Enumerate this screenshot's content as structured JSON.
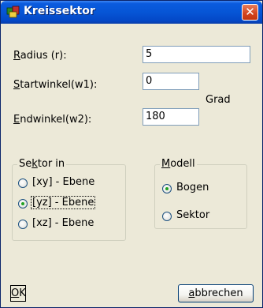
{
  "window": {
    "title": "Kreissektor",
    "close_glyph": "✕"
  },
  "fields": {
    "radius": {
      "label_u": "R",
      "label_rest": "adius (r):",
      "value": "5"
    },
    "start": {
      "label_u": "S",
      "label_rest": "tartwinkel(w1):",
      "value": "0"
    },
    "end": {
      "label_u": "E",
      "label_rest": "ndwinkel(w2):",
      "value": "180"
    },
    "unit": "Grad"
  },
  "sektor_group": {
    "title_pre": "Se",
    "title_u": "k",
    "title_post": "tor in",
    "options": [
      {
        "label": "[xy] - Ebene",
        "checked": false
      },
      {
        "label": "[yz] - Ebene",
        "checked": true
      },
      {
        "label": "[xz] - Ebene",
        "checked": false
      }
    ]
  },
  "modell_group": {
    "title_u": "M",
    "title_rest": "odell",
    "options": [
      {
        "label": "Bogen",
        "checked": true
      },
      {
        "label": "Sektor",
        "checked": false
      }
    ]
  },
  "buttons": {
    "ok_u": "O",
    "ok_rest": "K",
    "cancel_u": "a",
    "cancel_rest": "bbrechen"
  },
  "colors": {
    "titlebar": "#0655d6",
    "close": "#d3431e",
    "face": "#ece9d8",
    "radio_dot": "#21a121"
  },
  "icons": {
    "app": "app-icon",
    "close": "close-icon"
  }
}
